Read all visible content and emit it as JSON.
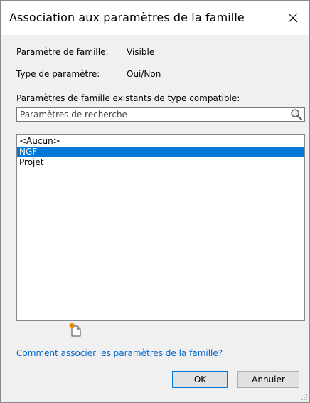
{
  "dialog": {
    "title": "Association aux paramètres de la famille",
    "close_icon": "close-icon"
  },
  "info": {
    "family_param_label": "Paramètre de famille:",
    "family_param_value": "Visible",
    "param_type_label": "Type de paramètre:",
    "param_type_value": "Oui/Non",
    "existing_params_label": "Paramètres de famille existants de type compatible:"
  },
  "search": {
    "placeholder": "Paramètres de recherche",
    "value": "",
    "icon": "search-icon"
  },
  "list": {
    "items": [
      {
        "label": "<Aucun>",
        "selected": false
      },
      {
        "label": "NGF",
        "selected": true
      },
      {
        "label": "Projet",
        "selected": false
      }
    ]
  },
  "toolbar": {
    "new_param_icon": "new-parameter-icon"
  },
  "help": {
    "link_text": "Comment associer les paramètres de la famille?"
  },
  "buttons": {
    "ok_label": "OK",
    "cancel_label": "Annuler"
  },
  "colors": {
    "selection": "#0078d7",
    "link": "#0066cc",
    "background": "#f0f0f0"
  }
}
